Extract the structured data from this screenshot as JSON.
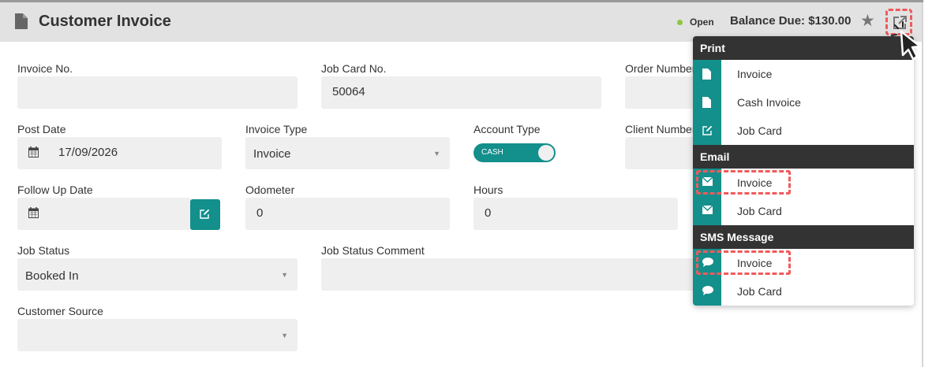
{
  "header": {
    "title": "Customer Invoice",
    "status": "Open",
    "balance": "Balance Due: $130.00"
  },
  "form": {
    "invoice_no": {
      "label": "Invoice No.",
      "value": ""
    },
    "job_card_no": {
      "label": "Job Card No.",
      "value": "50064"
    },
    "order_number": {
      "label": "Order Number"
    },
    "post_date": {
      "label": "Post Date",
      "value": "17/09/2026"
    },
    "invoice_type": {
      "label": "Invoice Type",
      "value": "Invoice"
    },
    "account_type": {
      "label": "Account Type",
      "value": "CASH"
    },
    "client_number": {
      "label": "Client Number"
    },
    "follow_up_date": {
      "label": "Follow Up Date",
      "value": ""
    },
    "odometer": {
      "label": "Odometer",
      "value": "0"
    },
    "hours": {
      "label": "Hours",
      "value": "0"
    },
    "job_status": {
      "label": "Job Status",
      "value": "Booked In"
    },
    "job_status_comment": {
      "label": "Job Status Comment",
      "value": ""
    },
    "customer_source": {
      "label": "Customer Source",
      "value": ""
    }
  },
  "menu": {
    "print": {
      "heading": "Print",
      "items": [
        "Invoice",
        "Cash Invoice",
        "Job Card"
      ]
    },
    "email": {
      "heading": "Email",
      "items": [
        "Invoice",
        "Job Card"
      ]
    },
    "sms": {
      "heading": "SMS Message",
      "items": [
        "Invoice",
        "Job Card"
      ]
    }
  },
  "colors": {
    "accent": "#138f8c",
    "highlight": "#f05a5a",
    "status_dot": "#8cc63f"
  },
  "icons": [
    "document-icon",
    "star-icon",
    "external-link-icon",
    "calendar-icon",
    "edit-icon",
    "envelope-icon",
    "chat-bubble-icon",
    "pointer-cursor-icon"
  ]
}
